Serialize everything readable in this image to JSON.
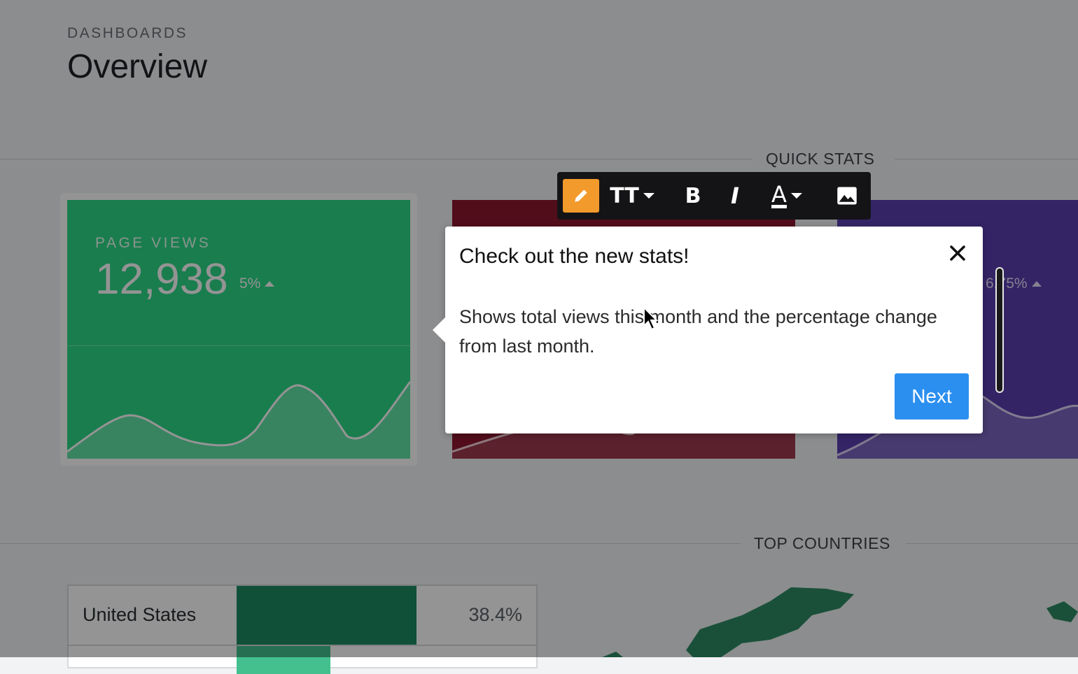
{
  "header": {
    "breadcrumb": "DASHBOARDS",
    "title": "Overview"
  },
  "quick_stats": {
    "section_label": "QUICK STATS",
    "cards": [
      {
        "label": "PAGE VIEWS",
        "value": "12,938",
        "change": "5%",
        "color": "#2dd887"
      },
      {
        "label": "",
        "value": "",
        "change": "",
        "color": "#8e1730"
      },
      {
        "label": "",
        "value": "",
        "change": "6.75%",
        "color": "#5a3fb0"
      }
    ]
  },
  "top_countries": {
    "section_label": "TOP COUNTRIES",
    "rows": [
      {
        "country": "United States",
        "percent": "38.4%",
        "share": 0.384
      }
    ]
  },
  "toolbar": {
    "buttons": [
      {
        "icon": "pencil-icon",
        "active": true
      },
      {
        "icon": "text-size-icon",
        "label": "TT"
      },
      {
        "icon": "bold-icon",
        "label": "B"
      },
      {
        "icon": "italic-icon",
        "label": "I"
      },
      {
        "icon": "text-color-icon",
        "label": "A"
      },
      {
        "icon": "image-icon"
      }
    ],
    "accent": "#f39a2c"
  },
  "tour_popover": {
    "title": "Check out the new stats!",
    "body": "Shows total views this month and the percentage change from last month.",
    "next_label": "Next"
  }
}
